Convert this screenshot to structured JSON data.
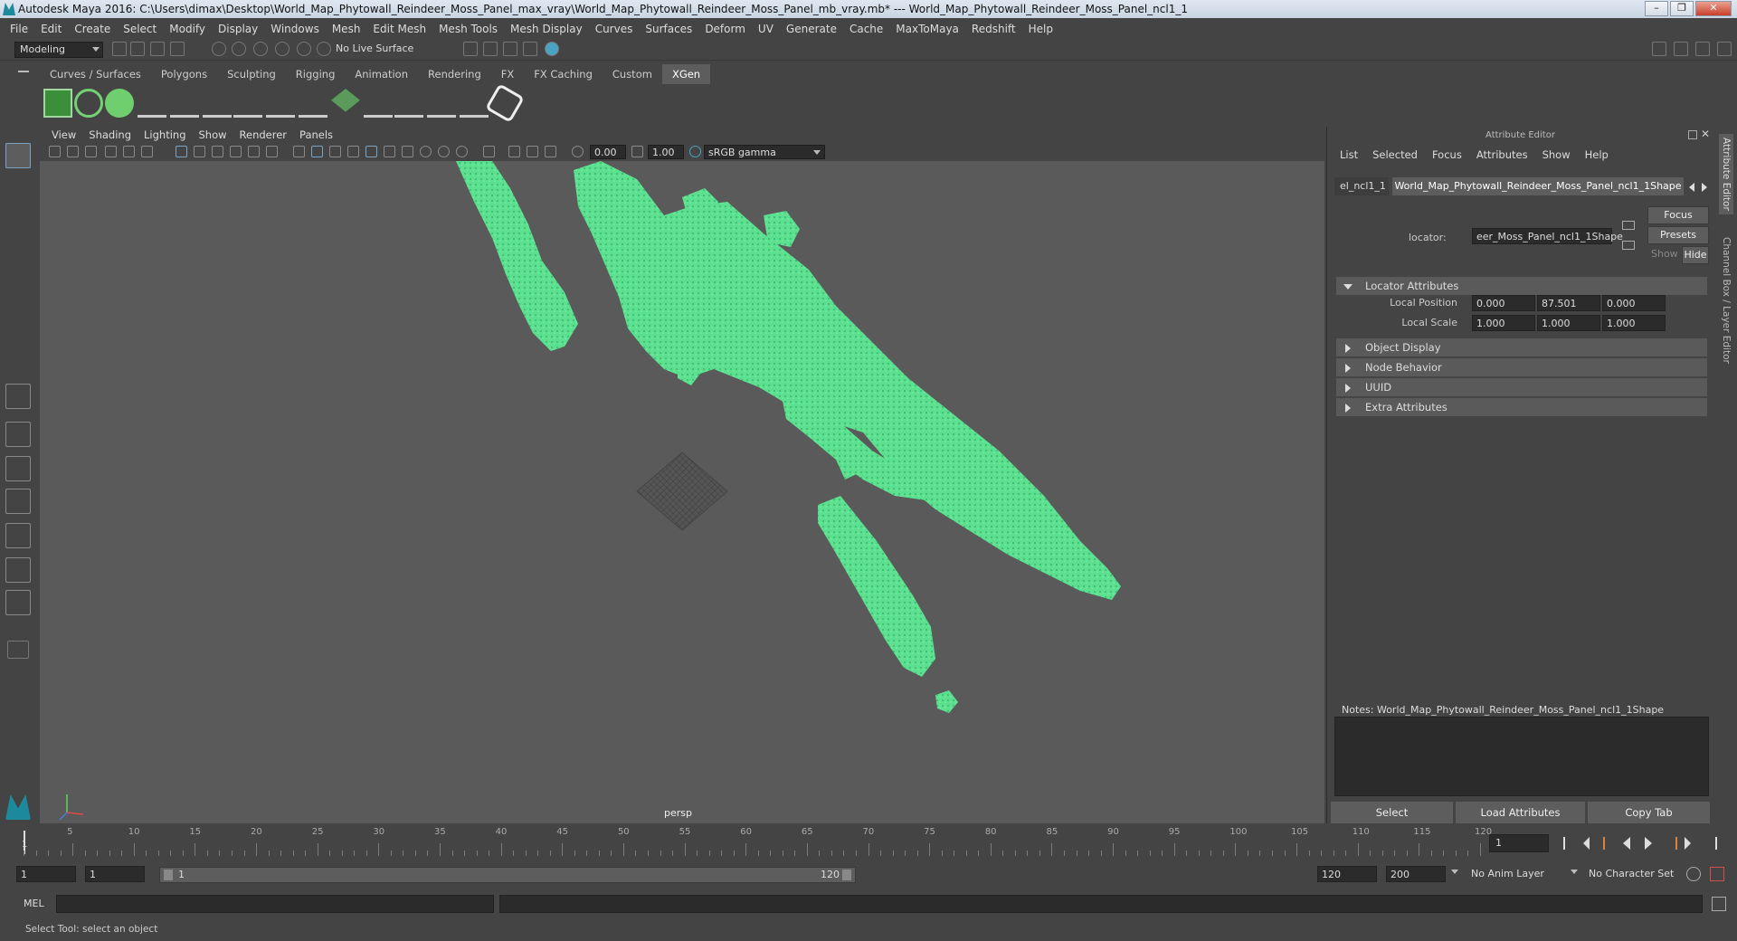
{
  "window": {
    "title": "Autodesk Maya 2016: C:\\Users\\dimax\\Desktop\\World_Map_Phytowall_Reindeer_Moss_Panel_max_vray\\World_Map_Phytowall_Reindeer_Moss_Panel_mb_vray.mb*  ---  World_Map_Phytowall_Reindeer_Moss_Panel_ncl1_1"
  },
  "menubar": [
    "File",
    "Edit",
    "Create",
    "Select",
    "Modify",
    "Display",
    "Windows",
    "Mesh",
    "Edit Mesh",
    "Mesh Tools",
    "Mesh Display",
    "Curves",
    "Surfaces",
    "Deform",
    "UV",
    "Generate",
    "Cache",
    "MaxToMaya",
    "Redshift",
    "Help"
  ],
  "statusline": {
    "mode": "Modeling",
    "live_surface": "No Live Surface"
  },
  "shelf_tabs": [
    "Curves / Surfaces",
    "Polygons",
    "Sculpting",
    "Rigging",
    "Animation",
    "Rendering",
    "FX",
    "FX Caching",
    "Custom",
    "XGen"
  ],
  "viewport": {
    "menu": [
      "View",
      "Shading",
      "Lighting",
      "Show",
      "Renderer",
      "Panels"
    ],
    "exposure": "0.00",
    "gamma": "1.00",
    "color_space": "sRGB gamma",
    "camera_label": "persp"
  },
  "attribute_editor": {
    "title": "Attribute Editor",
    "menu": [
      "List",
      "Selected",
      "Focus",
      "Attributes",
      "Show",
      "Help"
    ],
    "tabs": [
      "el_ncl1_1",
      "World_Map_Phytowall_Reindeer_Moss_Panel_ncl1_1Shape"
    ],
    "locator_label": "locator:",
    "locator_value": "eer_Moss_Panel_ncl1_1Shape",
    "focus_btn": "Focus",
    "presets_btn": "Presets",
    "show_label": "Show",
    "hide_btn": "Hide",
    "sections": [
      "Locator Attributes",
      "Object Display",
      "Node Behavior",
      "UUID",
      "Extra Attributes"
    ],
    "local_position_label": "Local Position",
    "local_position": [
      "0.000",
      "87.501",
      "0.000"
    ],
    "local_scale_label": "Local Scale",
    "local_scale": [
      "1.000",
      "1.000",
      "1.000"
    ],
    "notes_label": "Notes:  World_Map_Phytowall_Reindeer_Moss_Panel_ncl1_1Shape",
    "bottom_buttons": [
      "Select",
      "Load Attributes",
      "Copy Tab"
    ]
  },
  "side_tabs": [
    "Attribute Editor",
    "Channel Box / Layer Editor"
  ],
  "timeline": {
    "ticks": [
      "5",
      "10",
      "15",
      "20",
      "25",
      "30",
      "35",
      "40",
      "45",
      "50",
      "55",
      "60",
      "65",
      "70",
      "75",
      "80",
      "85",
      "90",
      "95",
      "100",
      "105",
      "110",
      "115",
      "120"
    ],
    "current_start": "1",
    "current_frame": "1"
  },
  "range": {
    "start": "1",
    "playback_start": "1",
    "slider_start": "1",
    "slider_end": "120",
    "playback_end": "120",
    "end": "200",
    "anim_layer": "No Anim Layer",
    "character_set": "No Character Set"
  },
  "mel_label": "MEL",
  "help_line": "Select Tool: select an object",
  "colors": {
    "moss": "#5be08f",
    "accent": "#5d5d5d"
  }
}
